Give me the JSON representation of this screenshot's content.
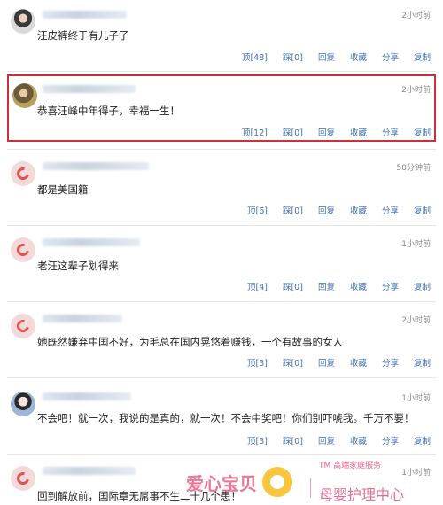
{
  "comments": [
    {
      "time": "2小时前",
      "text": "汪皮裤终于有儿子了",
      "avatar": "photo-avatar",
      "actions": {
        "up": "顶[48]",
        "down": "踩[0]",
        "reply": "回复",
        "fav": "收藏",
        "share": "分享",
        "copy": "复制"
      }
    },
    {
      "time": "2小时前",
      "text": "恭喜汪峰中年得子，幸福一生！",
      "avatar": "photo-avatar",
      "actions": {
        "up": "顶[12]",
        "down": "踩[0]",
        "reply": "回复",
        "fav": "收藏",
        "share": "分享",
        "copy": "复制"
      }
    },
    {
      "time": "58分钟前",
      "text": "都是美国籍",
      "avatar": "default-avatar",
      "actions": {
        "up": "顶[6]",
        "down": "踩[0]",
        "reply": "回复",
        "fav": "收藏",
        "share": "分享",
        "copy": "复制"
      }
    },
    {
      "time": "1小时前",
      "text": "老汪这辈子划得来",
      "avatar": "default-avatar",
      "actions": {
        "up": "顶[4]",
        "down": "踩[0]",
        "reply": "回复",
        "fav": "收藏",
        "share": "分享",
        "copy": "复制"
      }
    },
    {
      "time": "2小时前",
      "text": "她既然嫌弃中国不好，为毛总在国内晃悠着赚钱，一个有故事的女人",
      "avatar": "default-avatar",
      "actions": {
        "up": "顶[3]",
        "down": "踩[0]",
        "reply": "回复",
        "fav": "收藏",
        "share": "分享",
        "copy": "复制"
      }
    },
    {
      "time": "1小时前",
      "text": "不会吧！就一次，我说的是真的，就一次！不会中奖吧！你们别吓唬我。千万不要！",
      "avatar": "photo-avatar",
      "actions": {
        "up": "顶[3]",
        "down": "踩[0]",
        "reply": "回复",
        "fav": "收藏",
        "share": "分享",
        "copy": "复制"
      }
    },
    {
      "time": "1小时前",
      "text": "回到解放前，国际章无屌事不生二十几个患！",
      "avatar": "default-avatar"
    }
  ],
  "watermark": {
    "brand": "爱心宝贝",
    "tm": "TM 高端家庭服务",
    "sub": "母婴护理中心"
  },
  "colors": {
    "link": "#3f6fb5",
    "highlight": "#c9303a",
    "watermark": "#e23c6b"
  }
}
